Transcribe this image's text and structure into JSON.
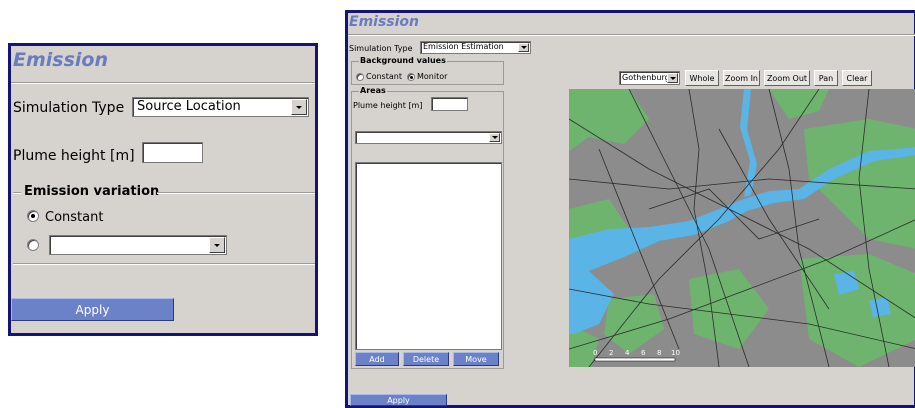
{
  "left_panel": {
    "title": "Emission",
    "simulation_type_label": "Simulation Type",
    "simulation_type_value": "Source Location",
    "plume_height_label": "Plume height [m]",
    "plume_height_value": "",
    "emission_variation_label": "Emission variation",
    "constant_label": "Constant",
    "constant_selected": true,
    "variation_select_value": "",
    "apply_label": "Apply"
  },
  "right_panel": {
    "title": "Emission",
    "simulation_type_label": "Simulation Type",
    "simulation_type_value": "Emission Estimation",
    "background_values_label": "Background values",
    "constant_label": "Constant",
    "monitor_label": "Monitor",
    "monitor_selected": true,
    "areas_label": "Areas",
    "plume_height_label": "Plume height [m]",
    "plume_height_value": "",
    "area_select_value": "",
    "add_label": "Add",
    "delete_label": "Delete",
    "move_label": "Move",
    "apply_label": "Apply",
    "map_toolbar": {
      "city_value": "Gothenburg",
      "whole_label": "Whole",
      "zoom_in_label": "Zoom In",
      "zoom_out_label": "Zoom Out",
      "pan_label": "Pan",
      "clear_label": "Clear"
    },
    "scale_labels": [
      "0",
      "2",
      "4",
      "6",
      "8",
      "10"
    ]
  },
  "colors": {
    "panel_border": "#141478",
    "title_color": "#6b7bbd",
    "panel_bg": "#d6d3ce",
    "button_blue": "#6b82c8",
    "map_land": "#8c8c8c",
    "map_green": "#6eb46e",
    "map_water": "#5ab4e6"
  }
}
